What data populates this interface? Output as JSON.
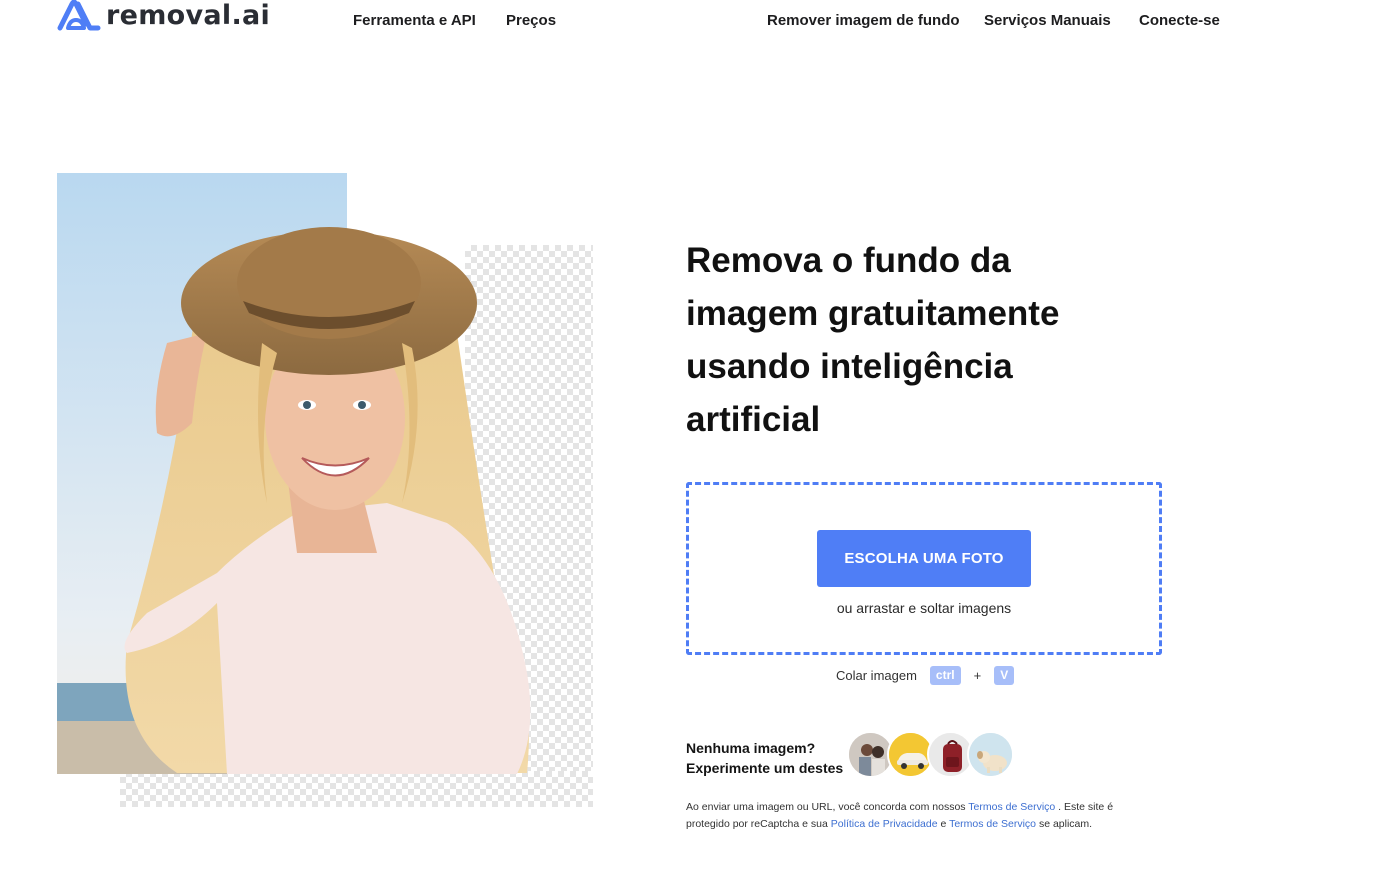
{
  "brand": {
    "name": "removal.ai",
    "accent": "#4f7ef6"
  },
  "nav": {
    "left": [
      {
        "label": "Ferramenta e API"
      },
      {
        "label": "Preços"
      }
    ],
    "right": [
      {
        "label": "Remover imagem de fundo"
      },
      {
        "label": "Serviços Manuais"
      },
      {
        "label": "Conecte-se"
      }
    ]
  },
  "hero": {
    "headline": "Remova o fundo da imagem gratuitamente usando inteligência artificial"
  },
  "upload": {
    "button_label": "ESCOLHA UMA FOTO",
    "drop_text": "ou arrastar e soltar imagens"
  },
  "paste": {
    "label": "Colar imagem",
    "key1": "ctrl",
    "plus": "+",
    "key2": "V"
  },
  "samples": {
    "line1": "Nenhuma imagem?",
    "line2": "Experimente um destes",
    "items": [
      "family-photo",
      "car-photo",
      "backpack-photo",
      "dog-photo"
    ]
  },
  "legal": {
    "part1": "Ao enviar uma imagem ou URL, você concorda com nossos",
    "terms_link": "Termos de Serviço",
    "part2": ". Este site é protegido por reCaptcha e sua",
    "privacy_link": "Política de Privacidade",
    "part3": "e",
    "terms_link2": "Termos de Serviço",
    "part4": "se aplicam."
  }
}
